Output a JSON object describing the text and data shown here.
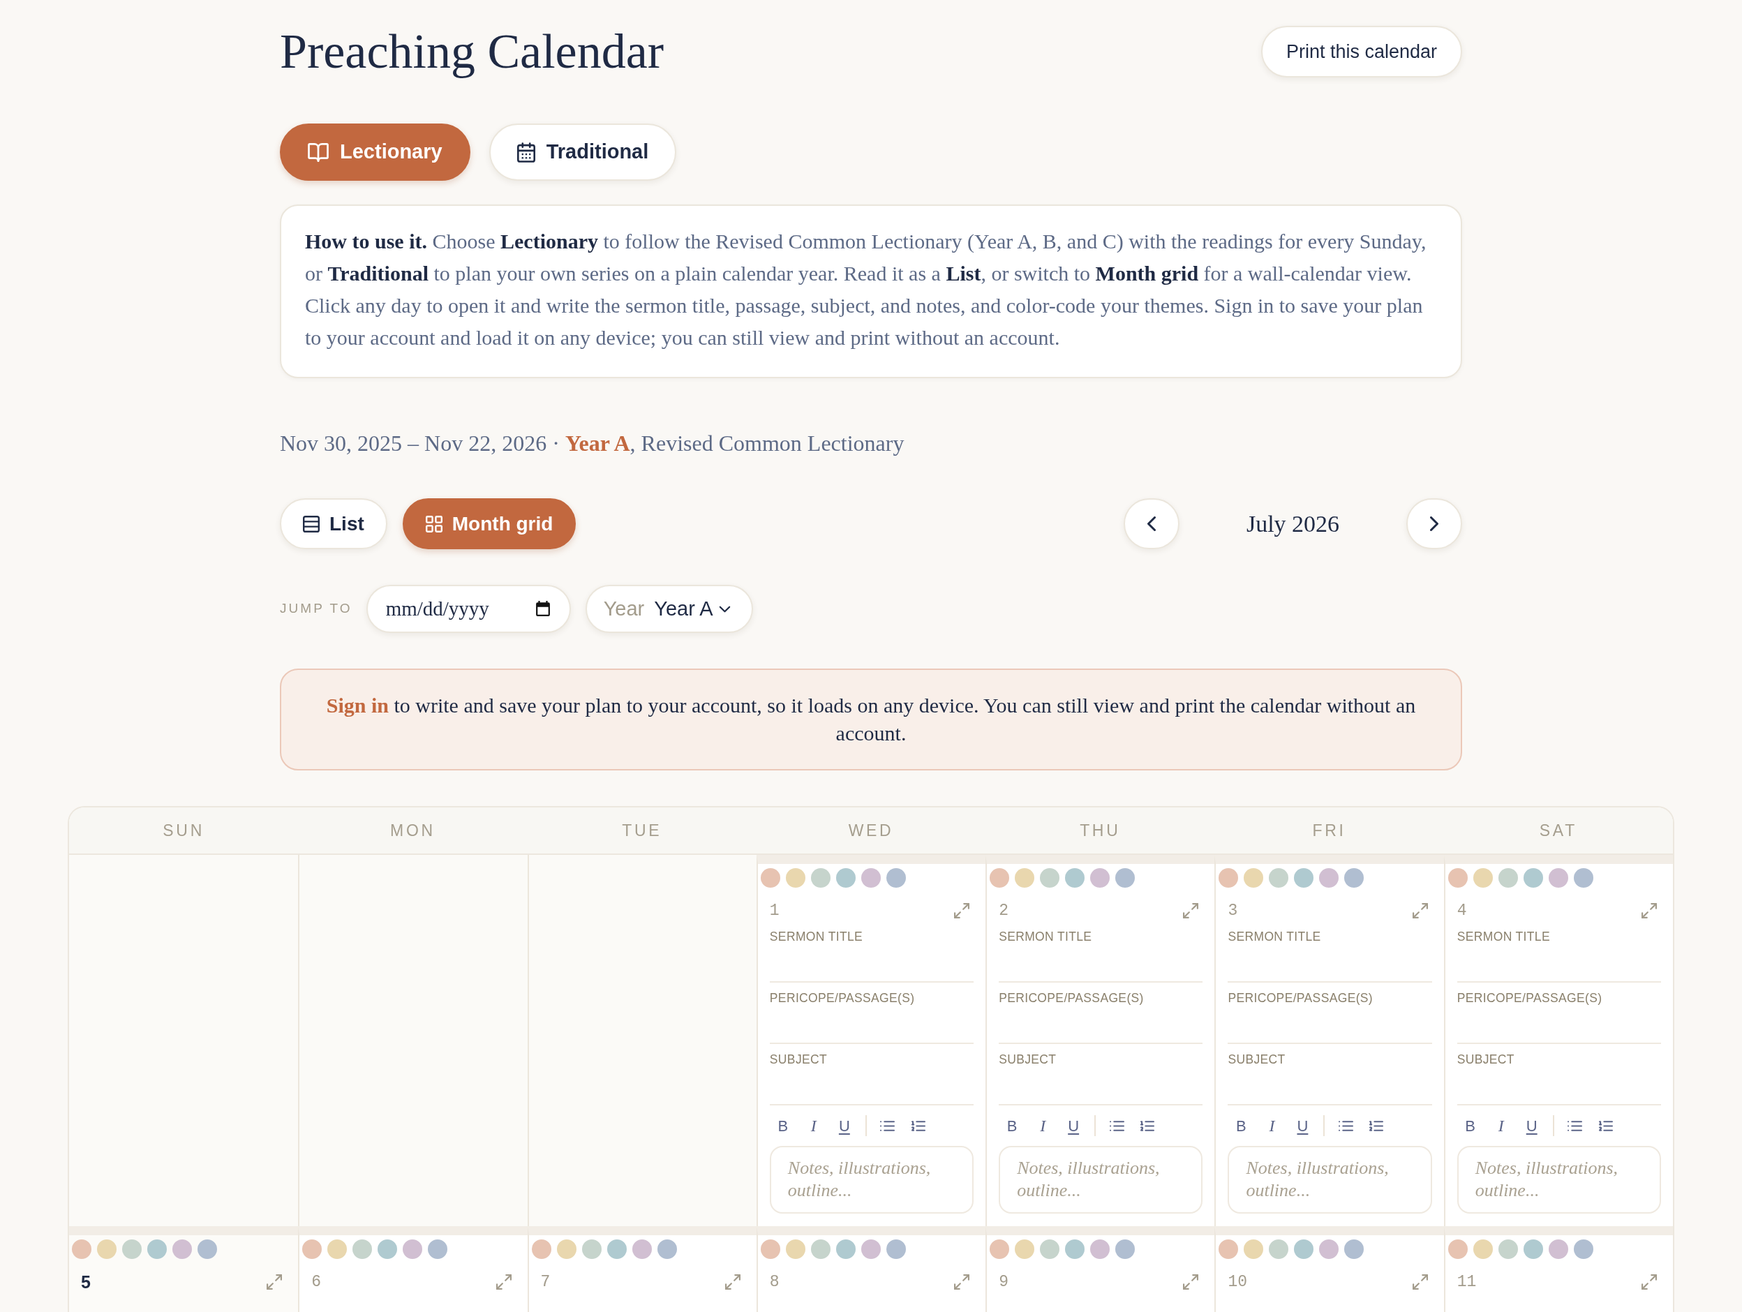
{
  "header": {
    "title": "Preaching Calendar",
    "print_button": "Print this calendar"
  },
  "modes": [
    {
      "kind": "lectionary",
      "label": "Lectionary",
      "selected": true
    },
    {
      "kind": "traditional",
      "label": "Traditional",
      "selected": false
    }
  ],
  "instructions": "**How to use it.** Choose **Lectionary** to follow the Revised Common Lectionary (Year A, B, and C) with the readings for every Sunday, or **Traditional** to plan your own series on a plain calendar year. Read it as a **List**, or switch to **Month grid** for a wall-calendar view. Click any day to open it and write the sermon title, passage, subject, and notes, and color-code your themes. Sign in to save your plan to your account and load it on any device; you can still view and print without an account.",
  "cycle_summary": "Nov 30, 2025 – Nov 22, 2026 · **Year A**, Revised Common Lectionary",
  "views": [
    {
      "kind": "list",
      "label": "List",
      "selected": false
    },
    {
      "kind": "grid",
      "label": "Month grid",
      "selected": true
    }
  ],
  "month_nav": {
    "month": "July 2026"
  },
  "jump": {
    "label": "JUMP TO",
    "date_placeholder": "mm/dd/yyyy",
    "year_label": "Year",
    "year_value": "Year A"
  },
  "notice": {
    "link": "Sign in",
    "text": "to write and save your plan to your account, so it loads on any device. You can still view and print the calendar without an account."
  },
  "calendar": {
    "weekdays": [
      "SUN",
      "MON",
      "TUE",
      "WED",
      "THU",
      "FRI",
      "SAT"
    ],
    "weeks": [
      {
        "days": [
          {
            "kind": "empty"
          },
          {
            "kind": "empty"
          },
          {
            "kind": "empty"
          },
          {
            "kind": "weekday",
            "number": "1",
            "swatches": [
              {
                "color": "#e7c3b1"
              },
              {
                "color": "#e9d7ae"
              },
              {
                "color": "#c6d4cc"
              },
              {
                "color": "#afcad0"
              },
              {
                "color": "#d1bfd2"
              },
              {
                "color": "#b0bed1"
              }
            ],
            "fields": [
              "SERMON TITLE",
              "PERICOPE/PASSAGE(S)",
              "SUBJECT"
            ],
            "toolbar": [
              {
                "kind": "bold",
                "label": "B"
              },
              {
                "kind": "italic",
                "label": "I"
              },
              {
                "kind": "underline",
                "label": "U"
              },
              {
                "kind": "bullets"
              },
              {
                "kind": "numbers"
              }
            ],
            "notes_placeholder": "Notes, illustrations, outline..."
          },
          {
            "kind": "weekday",
            "number": "2",
            "swatches": [
              {
                "color": "#e7c3b1"
              },
              {
                "color": "#e9d7ae"
              },
              {
                "color": "#c6d4cc"
              },
              {
                "color": "#afcad0"
              },
              {
                "color": "#d1bfd2"
              },
              {
                "color": "#b0bed1"
              }
            ],
            "fields": [
              "SERMON TITLE",
              "PERICOPE/PASSAGE(S)",
              "SUBJECT"
            ],
            "toolbar": [
              {
                "kind": "bold",
                "label": "B"
              },
              {
                "kind": "italic",
                "label": "I"
              },
              {
                "kind": "underline",
                "label": "U"
              },
              {
                "kind": "bullets"
              },
              {
                "kind": "numbers"
              }
            ],
            "notes_placeholder": "Notes, illustrations, outline..."
          },
          {
            "kind": "weekday",
            "number": "3",
            "swatches": [
              {
                "color": "#e7c3b1"
              },
              {
                "color": "#e9d7ae"
              },
              {
                "color": "#c6d4cc"
              },
              {
                "color": "#afcad0"
              },
              {
                "color": "#d1bfd2"
              },
              {
                "color": "#b0bed1"
              }
            ],
            "fields": [
              "SERMON TITLE",
              "PERICOPE/PASSAGE(S)",
              "SUBJECT"
            ],
            "toolbar": [
              {
                "kind": "bold",
                "label": "B"
              },
              {
                "kind": "italic",
                "label": "I"
              },
              {
                "kind": "underline",
                "label": "U"
              },
              {
                "kind": "bullets"
              },
              {
                "kind": "numbers"
              }
            ],
            "notes_placeholder": "Notes, illustrations, outline..."
          },
          {
            "kind": "weekday",
            "number": "4",
            "swatches": [
              {
                "color": "#e7c3b1"
              },
              {
                "color": "#e9d7ae"
              },
              {
                "color": "#c6d4cc"
              },
              {
                "color": "#afcad0"
              },
              {
                "color": "#d1bfd2"
              },
              {
                "color": "#b0bed1"
              }
            ],
            "fields": [
              "SERMON TITLE",
              "PERICOPE/PASSAGE(S)",
              "SUBJECT"
            ],
            "toolbar": [
              {
                "kind": "bold",
                "label": "B"
              },
              {
                "kind": "italic",
                "label": "I"
              },
              {
                "kind": "underline",
                "label": "U"
              },
              {
                "kind": "bullets"
              },
              {
                "kind": "numbers"
              }
            ],
            "notes_placeholder": "Notes, illustrations, outline..."
          }
        ]
      },
      {
        "days": [
          {
            "kind": "sunday",
            "number": "5",
            "swatches": [
              {
                "color": "#e7c3b1"
              },
              {
                "color": "#e9d7ae"
              },
              {
                "color": "#c6d4cc"
              },
              {
                "color": "#afcad0"
              },
              {
                "color": "#d1bfd2"
              },
              {
                "color": "#b0bed1"
              }
            ]
          },
          {
            "kind": "weekday",
            "number": "6",
            "swatches": [
              {
                "color": "#e7c3b1"
              },
              {
                "color": "#e9d7ae"
              },
              {
                "color": "#c6d4cc"
              },
              {
                "color": "#afcad0"
              },
              {
                "color": "#d1bfd2"
              },
              {
                "color": "#b0bed1"
              }
            ]
          },
          {
            "kind": "weekday",
            "number": "7",
            "swatches": [
              {
                "color": "#e7c3b1"
              },
              {
                "color": "#e9d7ae"
              },
              {
                "color": "#c6d4cc"
              },
              {
                "color": "#afcad0"
              },
              {
                "color": "#d1bfd2"
              },
              {
                "color": "#b0bed1"
              }
            ]
          },
          {
            "kind": "weekday",
            "number": "8",
            "swatches": [
              {
                "color": "#e7c3b1"
              },
              {
                "color": "#e9d7ae"
              },
              {
                "color": "#c6d4cc"
              },
              {
                "color": "#afcad0"
              },
              {
                "color": "#d1bfd2"
              },
              {
                "color": "#b0bed1"
              }
            ]
          },
          {
            "kind": "weekday",
            "number": "9",
            "swatches": [
              {
                "color": "#e7c3b1"
              },
              {
                "color": "#e9d7ae"
              },
              {
                "color": "#c6d4cc"
              },
              {
                "color": "#afcad0"
              },
              {
                "color": "#d1bfd2"
              },
              {
                "color": "#b0bed1"
              }
            ]
          },
          {
            "kind": "weekday",
            "number": "10",
            "swatches": [
              {
                "color": "#e7c3b1"
              },
              {
                "color": "#e9d7ae"
              },
              {
                "color": "#c6d4cc"
              },
              {
                "color": "#afcad0"
              },
              {
                "color": "#d1bfd2"
              },
              {
                "color": "#b0bed1"
              }
            ]
          },
          {
            "kind": "weekday",
            "number": "11",
            "swatches": [
              {
                "color": "#e7c3b1"
              },
              {
                "color": "#e9d7ae"
              },
              {
                "color": "#c6d4cc"
              },
              {
                "color": "#afcad0"
              },
              {
                "color": "#d1bfd2"
              },
              {
                "color": "#b0bed1"
              }
            ]
          }
        ]
      }
    ]
  }
}
